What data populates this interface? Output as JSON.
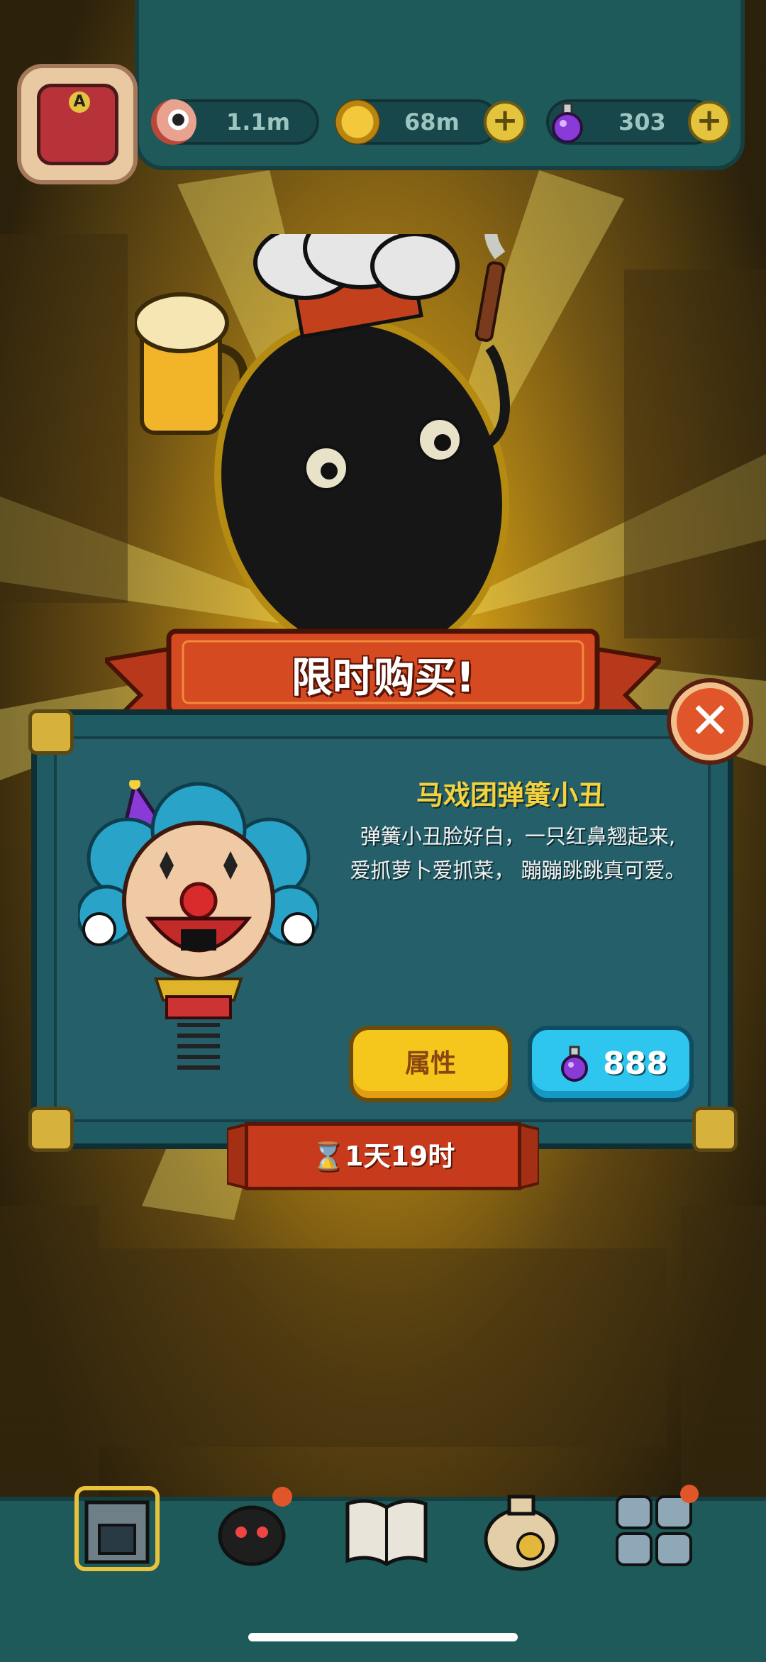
{
  "hud": {
    "avatar_letter": "A",
    "eyeballs": "1.1m",
    "coins": "68m",
    "potions": "303"
  },
  "banner": {
    "title": "限时购买!"
  },
  "offer": {
    "name": "马戏团弹簧小丑",
    "description_line1": "弹簧小丑脸好白，一只红鼻翘起来,",
    "description_line2": "爱抓萝卜爱抓菜， 蹦蹦跳跳真可爱。",
    "attr_button": "属性",
    "price": "888",
    "timer": "1天19时"
  },
  "icons": {
    "close": "close-icon",
    "eyeball": "eyeball-icon",
    "coin": "coin-icon",
    "potion": "potion-icon",
    "hourglass": "hourglass-icon"
  },
  "colors": {
    "panel": "#1e5b62",
    "banner": "#c83a1c",
    "title_yellow": "#f5d23c",
    "attr_button": "#f5c71d",
    "buy_button": "#2ec6ee"
  }
}
